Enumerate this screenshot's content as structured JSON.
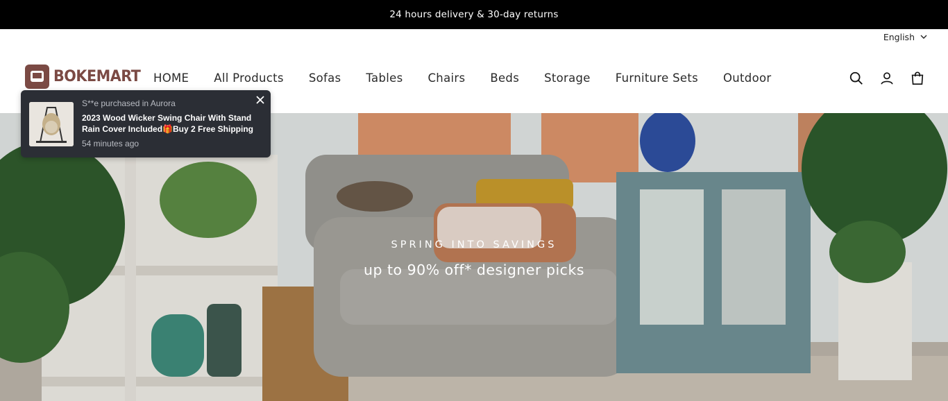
{
  "announcement": {
    "text": "24 hours delivery & 30-day returns"
  },
  "language": {
    "label": "English",
    "icon": "chevron-down-icon"
  },
  "brand": {
    "name": "BOKEMART",
    "color": "#7b4a44",
    "icon": "armchair-logo-icon"
  },
  "nav": {
    "items": [
      {
        "label": "HOME"
      },
      {
        "label": "All Products"
      },
      {
        "label": "Sofas"
      },
      {
        "label": "Tables"
      },
      {
        "label": "Chairs"
      },
      {
        "label": "Beds"
      },
      {
        "label": "Storage"
      },
      {
        "label": "Furniture Sets"
      },
      {
        "label": "Outdoor"
      }
    ]
  },
  "header_icons": [
    "search-icon",
    "account-icon",
    "cart-icon"
  ],
  "hero": {
    "eyebrow": "SPRING INTO SAVINGS",
    "headline": "up to 90% off* designer picks"
  },
  "toast": {
    "line1": "S**e purchased in Aurora",
    "title": "2023 Wood Wicker Swing Chair With Stand Rain Cover Included🎁Buy 2 Free Shipping",
    "time": "54 minutes ago",
    "close_icon": "close-icon",
    "bg": "#2b2e35"
  }
}
